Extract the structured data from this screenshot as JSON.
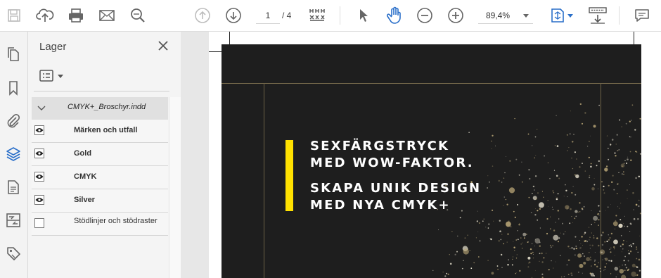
{
  "toolbar": {
    "page_current": "1",
    "page_total": "/ 4",
    "zoom": "89,4%",
    "icons": [
      "save-icon",
      "upload-icon",
      "print-icon",
      "mail-icon",
      "search-icon",
      "page-up-icon",
      "page-down-icon",
      "page-thumbnails-icon",
      "pointer-icon",
      "hand-icon",
      "zoom-out-icon",
      "zoom-in-icon",
      "fit-page-icon",
      "scroll-mode-icon",
      "comment-icon"
    ]
  },
  "rail": {
    "icons": [
      "pages-icon",
      "bookmark-icon",
      "attachment-icon",
      "layers-icon",
      "document-icon",
      "compare-icon",
      "tag-icon"
    ]
  },
  "layers_panel": {
    "title": "Lager",
    "root": "CMYK+_Broschyr.indd",
    "layers": [
      {
        "name": "Märken och utfall",
        "visible": true
      },
      {
        "name": "Gold",
        "visible": true
      },
      {
        "name": "CMYK",
        "visible": true
      },
      {
        "name": "Silver",
        "visible": true
      },
      {
        "name": "Stödlinjer och stödraster",
        "visible": false
      }
    ]
  },
  "document": {
    "headline_1": "SEXFÄRGSTRYCK",
    "headline_2": "MED WOW-FAKTOR.",
    "headline_3": "SKAPA UNIK DESIGN",
    "headline_4": "MED NYA CMYK+",
    "accent_color": "#ffe100",
    "background_color": "#1e1e1e"
  }
}
